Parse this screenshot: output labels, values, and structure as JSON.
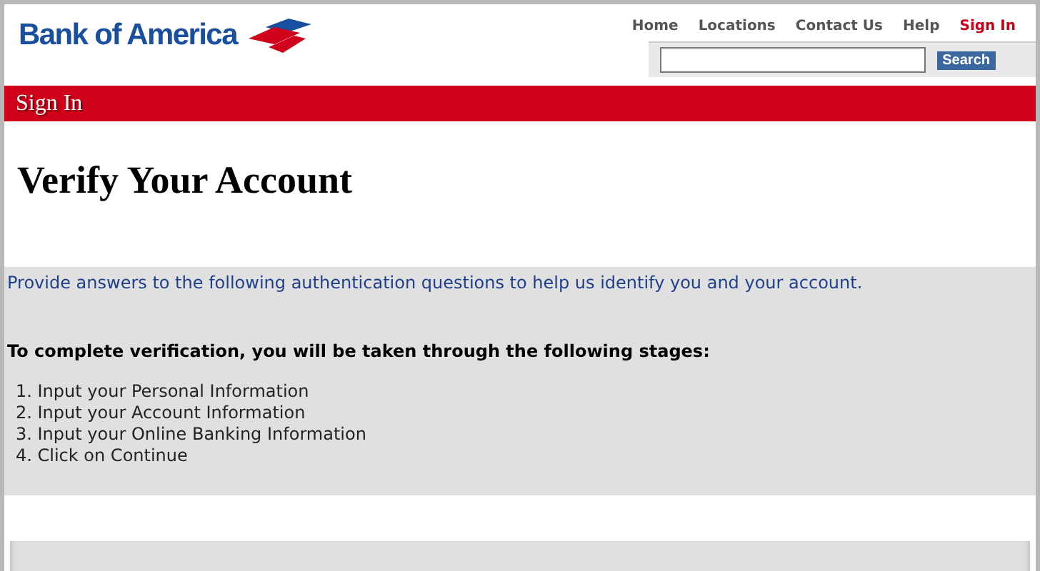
{
  "header": {
    "logo_text": "Bank of America",
    "nav": [
      {
        "label": "Home",
        "selected": false
      },
      {
        "label": "Locations",
        "selected": false
      },
      {
        "label": "Contact Us",
        "selected": false
      },
      {
        "label": "Help",
        "selected": false
      },
      {
        "label": "Sign In",
        "selected": true
      }
    ],
    "search_button": "Search"
  },
  "section_bar": "Sign In",
  "title": "Verify Your Account",
  "panel": {
    "intro": "Provide answers to the following authentication questions to help us identify you and your account.",
    "stages_heading": "To complete verification, you will be taken through the following stages:",
    "stages": [
      "1. Input your Personal Information",
      "2. Input your Account Information",
      "3. Input your Online Banking Information",
      "4. Click on Continue"
    ]
  }
}
